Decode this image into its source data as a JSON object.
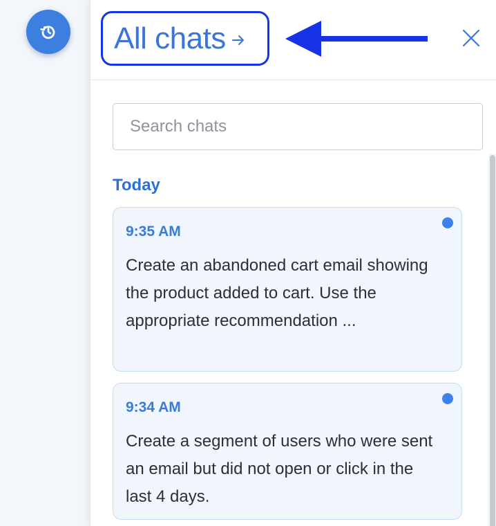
{
  "rail": {
    "history_button_icon": "history-icon"
  },
  "header": {
    "title": "All chats",
    "title_arrow_icon": "arrow-right-icon",
    "annotation_arrow_icon": "arrow-left-icon",
    "close_icon": "close-icon"
  },
  "search": {
    "placeholder": "Search chats",
    "value": ""
  },
  "sections": [
    {
      "label": "Today",
      "chats": [
        {
          "time": "9:35 AM",
          "preview": "Create an abandoned cart email showing the product added to cart. Use the appropriate recommendation ...",
          "unread": true
        },
        {
          "time": "9:34 AM",
          "preview": "Create a segment of users who were sent an email but did not open or click in the last 4 days.",
          "unread": true
        }
      ]
    }
  ],
  "colors": {
    "accent": "#3876dc",
    "annotation": "#1733e6",
    "card_bg": "#f1f6fd",
    "card_border": "#c6dcf3",
    "unread_dot": "#3d82e6"
  }
}
